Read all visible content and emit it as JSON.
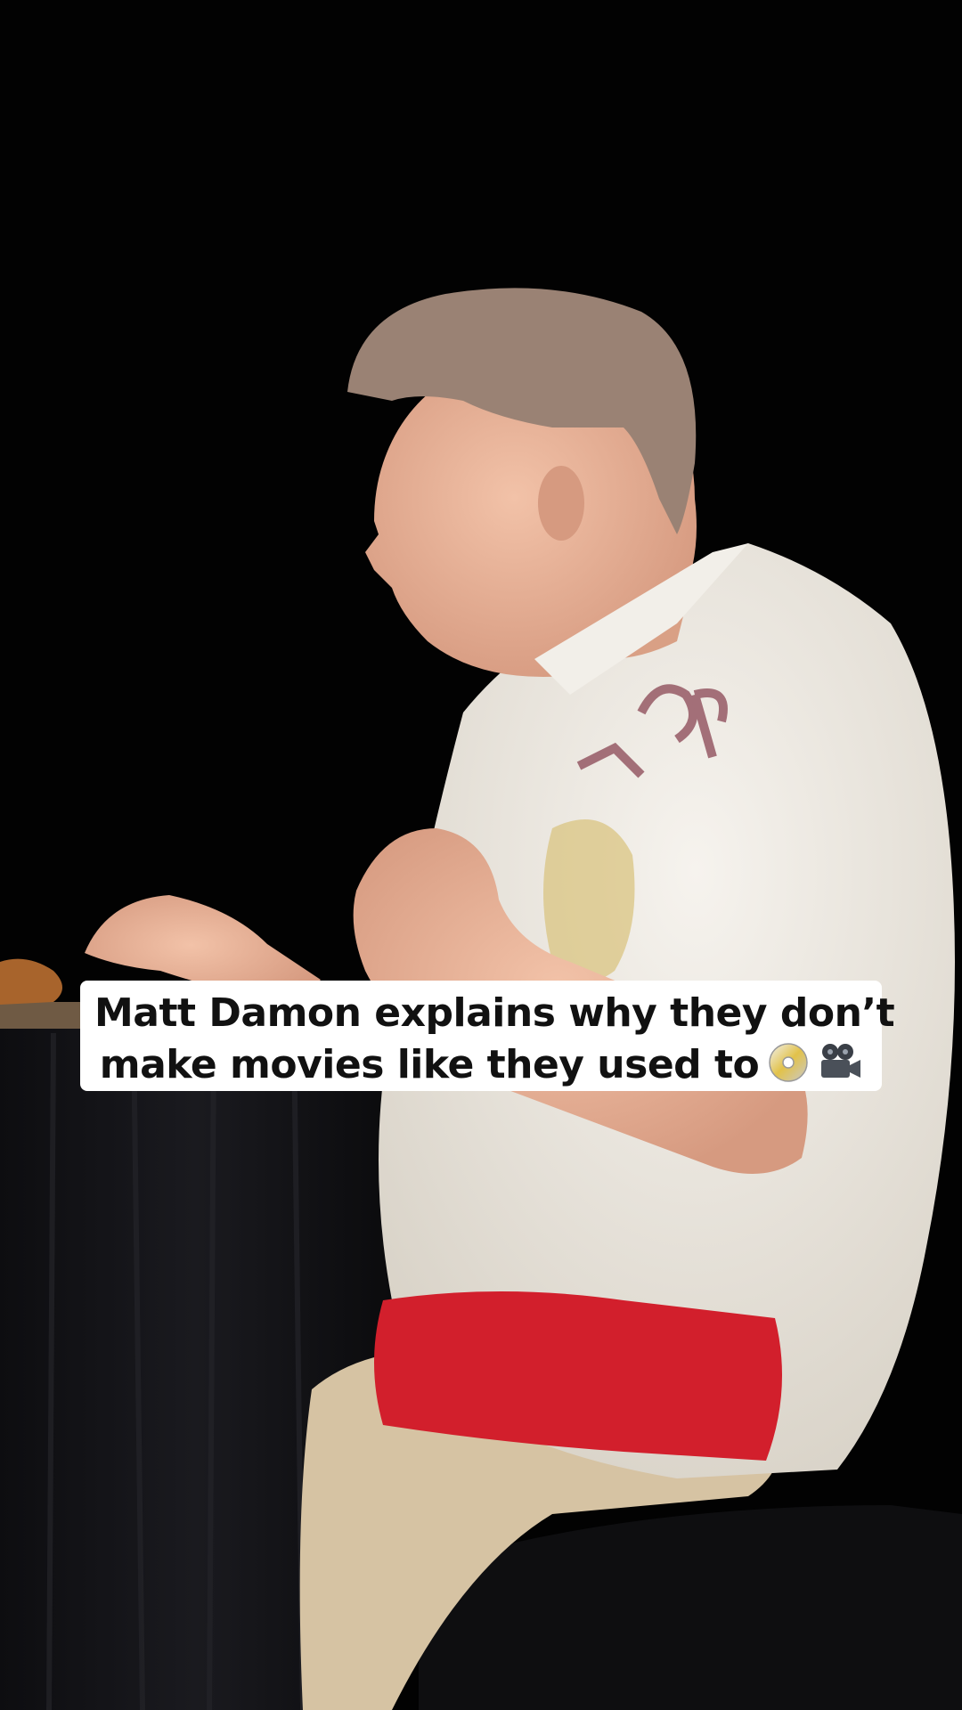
{
  "caption": {
    "line1": "Matt Damon explains why they don’t",
    "line2": "make movies like they used to"
  },
  "icons": {
    "disc": "dvd-disc-icon",
    "camera": "movie-camera-icon"
  },
  "colors": {
    "background": "#020202",
    "caption_bg": "#ffffff",
    "caption_text": "#111111",
    "shirt": "#ede9e1",
    "sash": "#d21f2c",
    "pants": "#d8c5a4",
    "table_cloth": "#121214",
    "skin": "#e9b39a",
    "hair": "#9a8274"
  }
}
